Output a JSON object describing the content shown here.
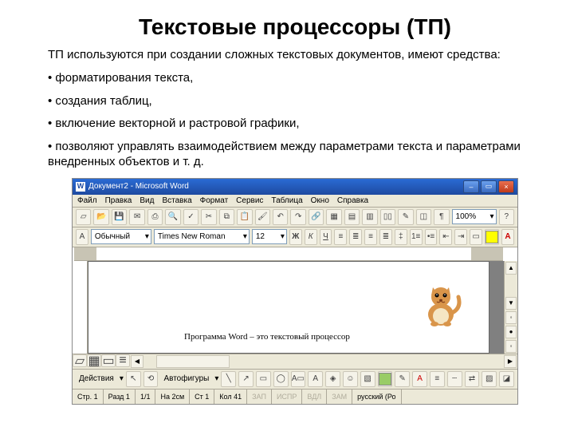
{
  "title": "Текстовые процессоры (ТП)",
  "intro": "ТП используются при создании сложных текстовых документов, имеют средства:",
  "bullets": [
    "форматирования текста,",
    "создания таблиц,",
    "включение векторной и растровой графики,",
    "позволяют управлять взаимодействием между параметрами текста и параметрами внедренных объектов и т. д."
  ],
  "word": {
    "titlebar": {
      "doc": "Документ2 - Microsoft Word"
    },
    "menu": [
      "Файл",
      "Правка",
      "Вид",
      "Вставка",
      "Формат",
      "Сервис",
      "Таблица",
      "Окно",
      "Справка"
    ],
    "toolbar1": {
      "zoom": "100%"
    },
    "toolbar2": {
      "style": "Обычный",
      "font": "Times New Roman",
      "size": "12"
    },
    "docline": "Программа Word – это текстовый процессор",
    "drawbar": {
      "actions": "Действия",
      "autoshapes": "Автофигуры"
    },
    "status": {
      "page": "Стр. 1",
      "sec": "Разд 1",
      "pg": "1/1",
      "at": "На 2см",
      "line": "Ст 1",
      "col": "Кол 41",
      "rec": "ЗАП",
      "trk": "ИСПР",
      "ext": "ВДЛ",
      "ovr": "ЗАМ",
      "lang": "русский (Ро"
    }
  }
}
